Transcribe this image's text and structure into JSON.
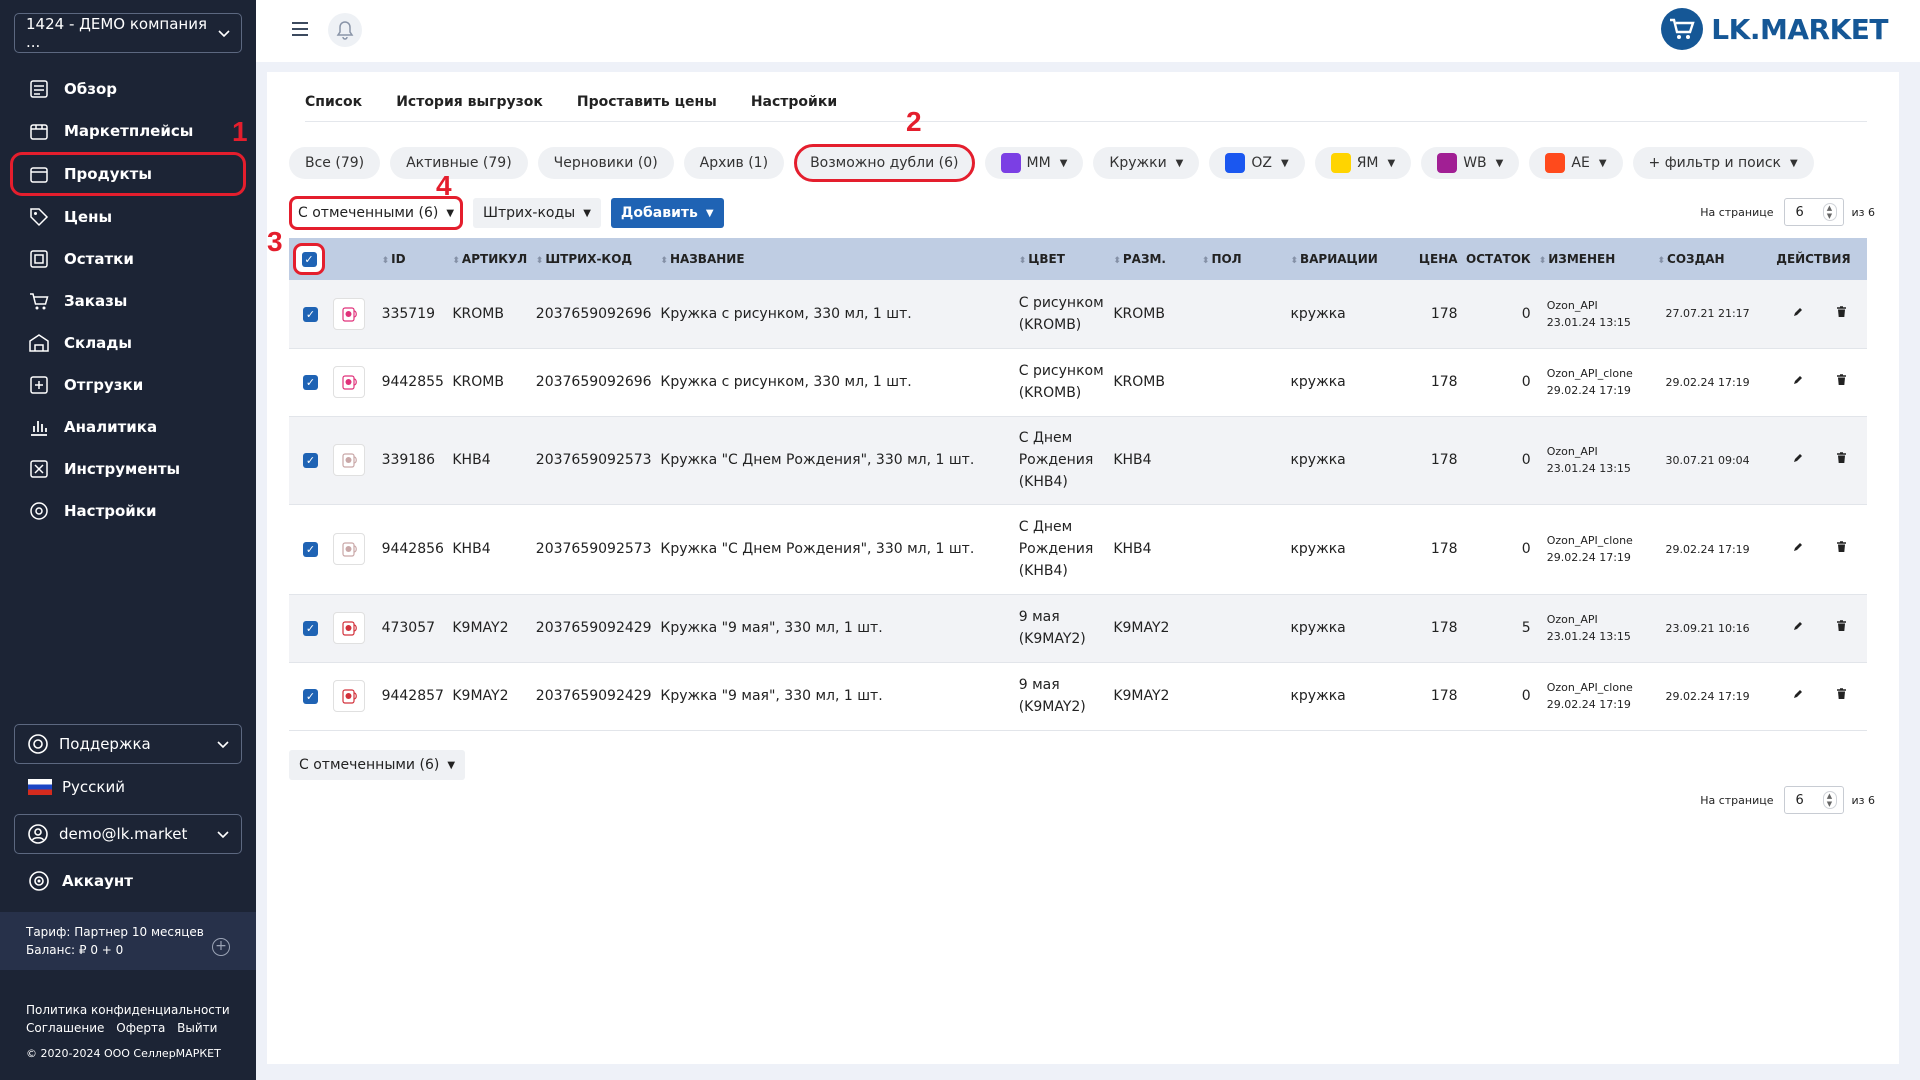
{
  "sidebar": {
    "company": "1424 - ДЕМО компания ...",
    "items": [
      {
        "label": "Обзор",
        "icon": "overview-icon"
      },
      {
        "label": "Маркетплейсы",
        "icon": "marketplace-icon"
      },
      {
        "label": "Продукты",
        "icon": "box-icon",
        "active": true
      },
      {
        "label": "Цены",
        "icon": "tag-icon"
      },
      {
        "label": "Остатки",
        "icon": "stock-icon"
      },
      {
        "label": "Заказы",
        "icon": "cart-icon"
      },
      {
        "label": "Склады",
        "icon": "warehouse-icon"
      },
      {
        "label": "Отгрузки",
        "icon": "shipment-icon"
      },
      {
        "label": "Аналитика",
        "icon": "analytics-icon"
      },
      {
        "label": "Инструменты",
        "icon": "tools-icon"
      },
      {
        "label": "Настройки",
        "icon": "settings-icon"
      }
    ],
    "support": "Поддержка",
    "language": "Русский",
    "user": "demo@lk.market",
    "account": "Аккаунт",
    "tariff": "Тариф: Партнер 10 месяцев",
    "balance": "Баланс: ₽ 0 + 0",
    "footer": {
      "privacy": "Политика конфиденциальности",
      "agreement": "Соглашение",
      "offer": "Оферта",
      "logout": "Выйти",
      "copyright": "© 2020-2024 ООО СеллерМАРКЕТ"
    }
  },
  "header": {
    "logo_text": "LK.MARKET"
  },
  "tabs": [
    "Список",
    "История выгрузок",
    "Проставить цены",
    "Настройки"
  ],
  "chips": [
    {
      "label": "Все (79)"
    },
    {
      "label": "Активные (79)"
    },
    {
      "label": "Черновики (0)"
    },
    {
      "label": "Архив (1)"
    },
    {
      "label": "Возможно дубли (6)",
      "highlight": true
    },
    {
      "label": "MM",
      "badge": "MM",
      "badge_color": "#7b3fe4",
      "dropdown": true
    },
    {
      "label": "Кружки",
      "dropdown": true
    },
    {
      "label": "OZ",
      "badge": "ozon",
      "badge_color": "#1a57f0",
      "dropdown": true
    },
    {
      "label": "ЯМ",
      "badge": "ЯМ",
      "badge_color": "#ffd400",
      "dropdown": true
    },
    {
      "label": "WB",
      "badge": "WB",
      "badge_color": "#a11f94",
      "dropdown": true
    },
    {
      "label": "AE",
      "badge": "AE",
      "badge_color": "#ff4a1c",
      "dropdown": true
    },
    {
      "label": "+ фильтр и поиск",
      "dropdown": true
    }
  ],
  "toolbar": {
    "selected": "С отмеченными (6)",
    "barcodes": "Штрих-коды",
    "add": "Добавить"
  },
  "pager": {
    "label": "На странице",
    "value": "6",
    "of": "из 6"
  },
  "annotations": [
    "1",
    "2",
    "3",
    "4"
  ],
  "table": {
    "headers": [
      "ID",
      "АРТИКУЛ",
      "ШТРИХ-КОД",
      "НАЗВАНИЕ",
      "ЦВЕТ",
      "РАЗМ.",
      "ПОЛ",
      "ВАРИАЦИИ",
      "ЦЕНА",
      "ОСТАТОК",
      "ИЗМЕНЕН",
      "СОЗДАН",
      "ДЕЙСТВИЯ"
    ],
    "rows": [
      {
        "id": "335719",
        "article": "KROMB",
        "barcode": "2037659092696",
        "name": "Кружка с рисунком, 330 мл, 1 шт.",
        "color": [
          "С рисунком",
          "(KROMB)"
        ],
        "size": "KROMB",
        "gender": "",
        "variation": "кружка",
        "price": "178",
        "stock": "0",
        "changed_by": "Ozon_API",
        "changed_at": "23.01.24 13:15",
        "created": "27.07.21 21:17",
        "thumb_color": "#e0327a"
      },
      {
        "id": "9442855",
        "article": "KROMB",
        "barcode": "2037659092696",
        "name": "Кружка с рисунком, 330 мл, 1 шт.",
        "color": [
          "С рисунком",
          "(KROMB)"
        ],
        "size": "KROMB",
        "gender": "",
        "variation": "кружка",
        "price": "178",
        "stock": "0",
        "changed_by": "Ozon_API_clone",
        "changed_at": "29.02.24 17:19",
        "created": "29.02.24 17:19",
        "thumb_color": "#e0327a"
      },
      {
        "id": "339186",
        "article": "KHB4",
        "barcode": "2037659092573",
        "name": "Кружка \"С Днем Рождения\", 330 мл, 1 шт.",
        "color": [
          "С Днем",
          "Рождения",
          "(KHB4)"
        ],
        "size": "KHB4",
        "gender": "",
        "variation": "кружка",
        "price": "178",
        "stock": "0",
        "changed_by": "Ozon_API",
        "changed_at": "23.01.24 13:15",
        "created": "30.07.21 09:04",
        "thumb_color": "#c9a7a7"
      },
      {
        "id": "9442856",
        "article": "KHB4",
        "barcode": "2037659092573",
        "name": "Кружка \"С Днем Рождения\", 330 мл, 1 шт.",
        "color": [
          "С Днем",
          "Рождения",
          "(KHB4)"
        ],
        "size": "KHB4",
        "gender": "",
        "variation": "кружка",
        "price": "178",
        "stock": "0",
        "changed_by": "Ozon_API_clone",
        "changed_at": "29.02.24 17:19",
        "created": "29.02.24 17:19",
        "thumb_color": "#c9a7a7"
      },
      {
        "id": "473057",
        "article": "K9MAY2",
        "barcode": "2037659092429",
        "name": "Кружка \"9 мая\", 330 мл, 1 шт.",
        "color": [
          "9 мая",
          "(K9MAY2)"
        ],
        "size": "K9MAY2",
        "gender": "",
        "variation": "кружка",
        "price": "178",
        "stock": "5",
        "changed_by": "Ozon_API",
        "changed_at": "23.01.24 13:15",
        "created": "23.09.21 10:16",
        "thumb_color": "#d2303a"
      },
      {
        "id": "9442857",
        "article": "K9MAY2",
        "barcode": "2037659092429",
        "name": "Кружка \"9 мая\", 330 мл, 1 шт.",
        "color": [
          "9 мая",
          "(K9MAY2)"
        ],
        "size": "K9MAY2",
        "gender": "",
        "variation": "кружка",
        "price": "178",
        "stock": "0",
        "changed_by": "Ozon_API_clone",
        "changed_at": "29.02.24 17:19",
        "created": "29.02.24 17:19",
        "thumb_color": "#d2303a"
      }
    ]
  },
  "colors": {
    "sidebar_bg": "#1c2435",
    "accent": "#1f63b4",
    "highlight": "#e41e2d",
    "table_header": "#bfcde3"
  }
}
